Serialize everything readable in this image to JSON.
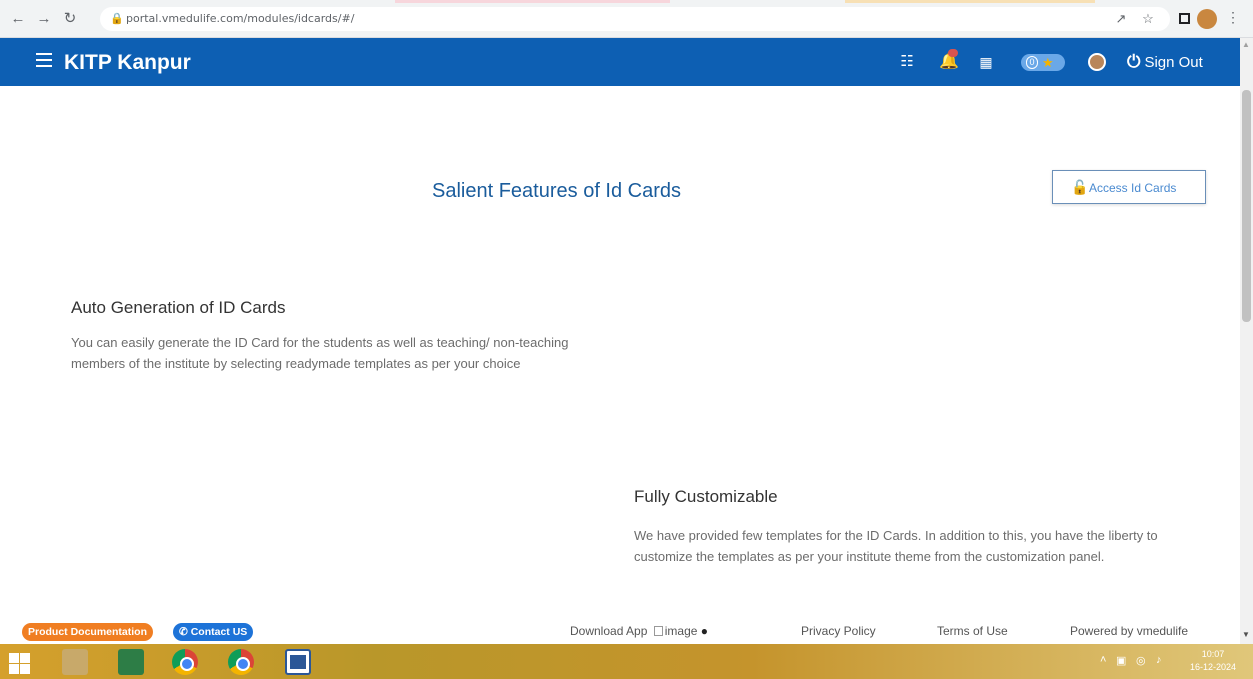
{
  "browser": {
    "url": "portal.vmedulife.com/modules/idcards/#/"
  },
  "header": {
    "brand": "KITP Kanpur",
    "trophy_count": "0",
    "sign_out": "Sign Out"
  },
  "main": {
    "title": "Salient Features of Id Cards",
    "access_button": "Access Id Cards",
    "features": [
      {
        "heading": "Auto Generation of ID Cards",
        "text": "You can easily generate the ID Card for the students as well as teaching/ non-teaching members of the institute by selecting readymade templates as per your choice"
      },
      {
        "heading": "Fully Customizable",
        "text": "We have provided few templates for the ID Cards. In addition to this, you have the liberty to customize the templates as per your institute theme from the customization panel."
      }
    ]
  },
  "footer": {
    "product_documentation": "Product Documentation",
    "contact_us": "Contact US",
    "download_app": "Download App",
    "image_alt": "image",
    "privacy_policy": "Privacy Policy",
    "terms_of_use": "Terms of Use",
    "powered_by": "Powered by vmedulife"
  },
  "taskbar": {
    "time": "10:07",
    "date": "16-12-2024"
  },
  "colors": {
    "header_blue": "#0d5fb3",
    "title_blue": "#1a5c9c",
    "doc_orange": "#f07e22",
    "contact_blue": "#1d73d8"
  }
}
